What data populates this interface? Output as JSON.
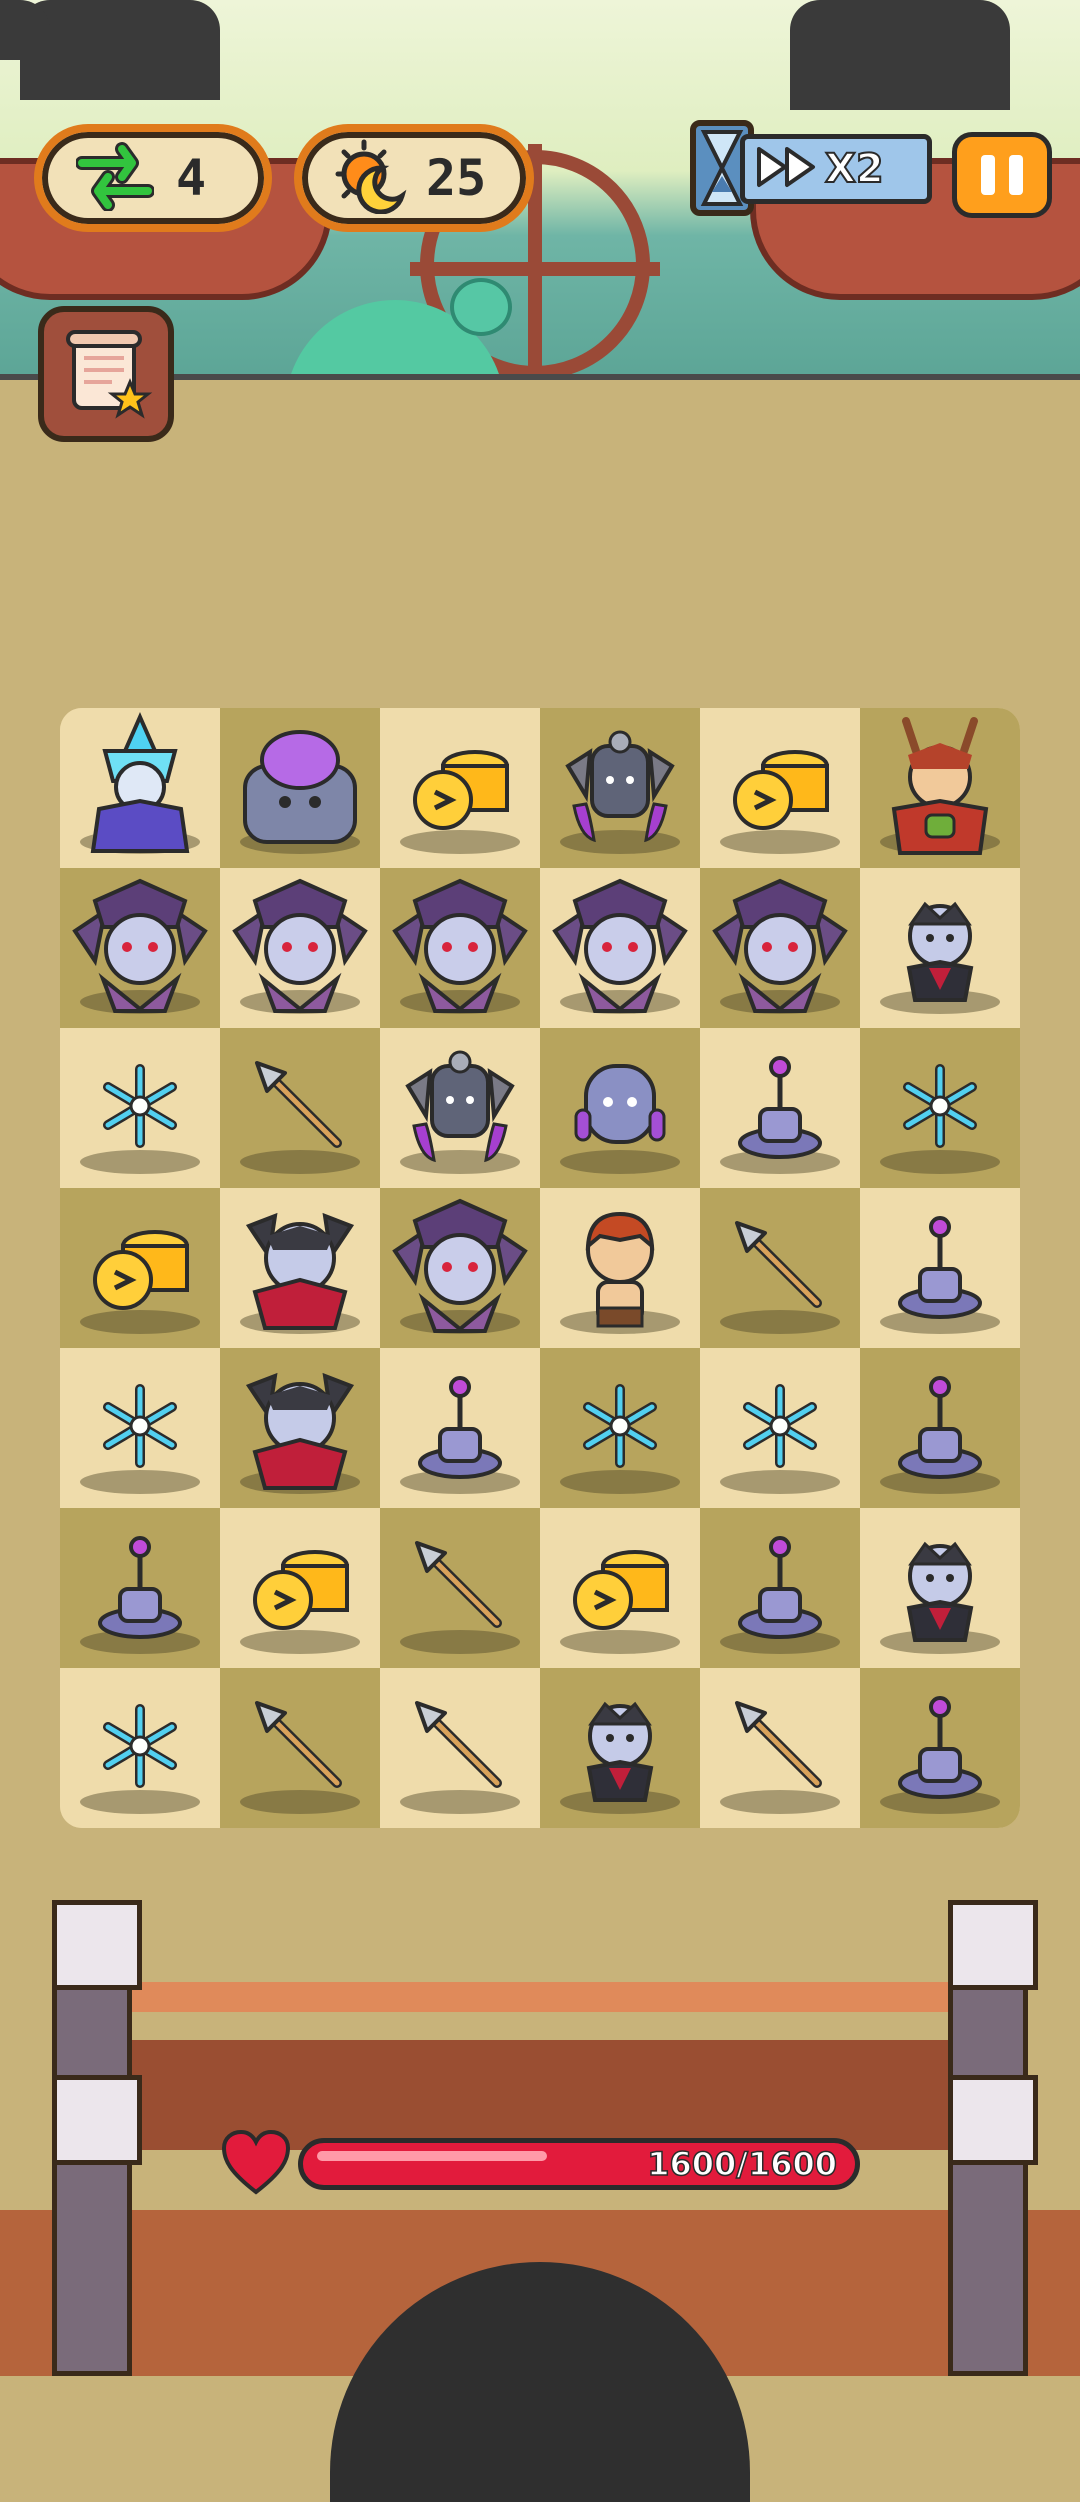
{
  "hud": {
    "swaps_count": "4",
    "energy_count": "25",
    "speed_label": "X2"
  },
  "health": {
    "text": "1600/1600",
    "fraction": 1.0
  },
  "colors": {
    "accent_orange": "#e07b1c",
    "health_red": "#e21b3c",
    "board_dark": "#b7a45d",
    "board_light": "#efdcab"
  },
  "board": {
    "rows": [
      [
        "ice-mage-hero",
        "purple-orb-golem",
        "gold-coins",
        "winged-guardian",
        "gold-coins",
        "deer-elf-hero"
      ],
      [
        "spider-demon",
        "spider-demon",
        "spider-demon",
        "spider-demon",
        "spider-demon",
        "vampire-small"
      ],
      [
        "snowflake",
        "spear",
        "winged-guardian",
        "blue-robot",
        "tesla-coil",
        "snowflake"
      ],
      [
        "gold-coins",
        "vampire-large",
        "spider-demon",
        "red-haired-kid",
        "spear",
        "tesla-coil"
      ],
      [
        "snowflake",
        "vampire-large",
        "tesla-coil",
        "snowflake",
        "snowflake",
        "tesla-coil"
      ],
      [
        "tesla-coil",
        "gold-coins",
        "spear",
        "gold-coins",
        "tesla-coil",
        "vampire-small"
      ],
      [
        "snowflake",
        "spear",
        "spear",
        "vampire-small",
        "spear",
        "tesla-coil"
      ]
    ]
  }
}
